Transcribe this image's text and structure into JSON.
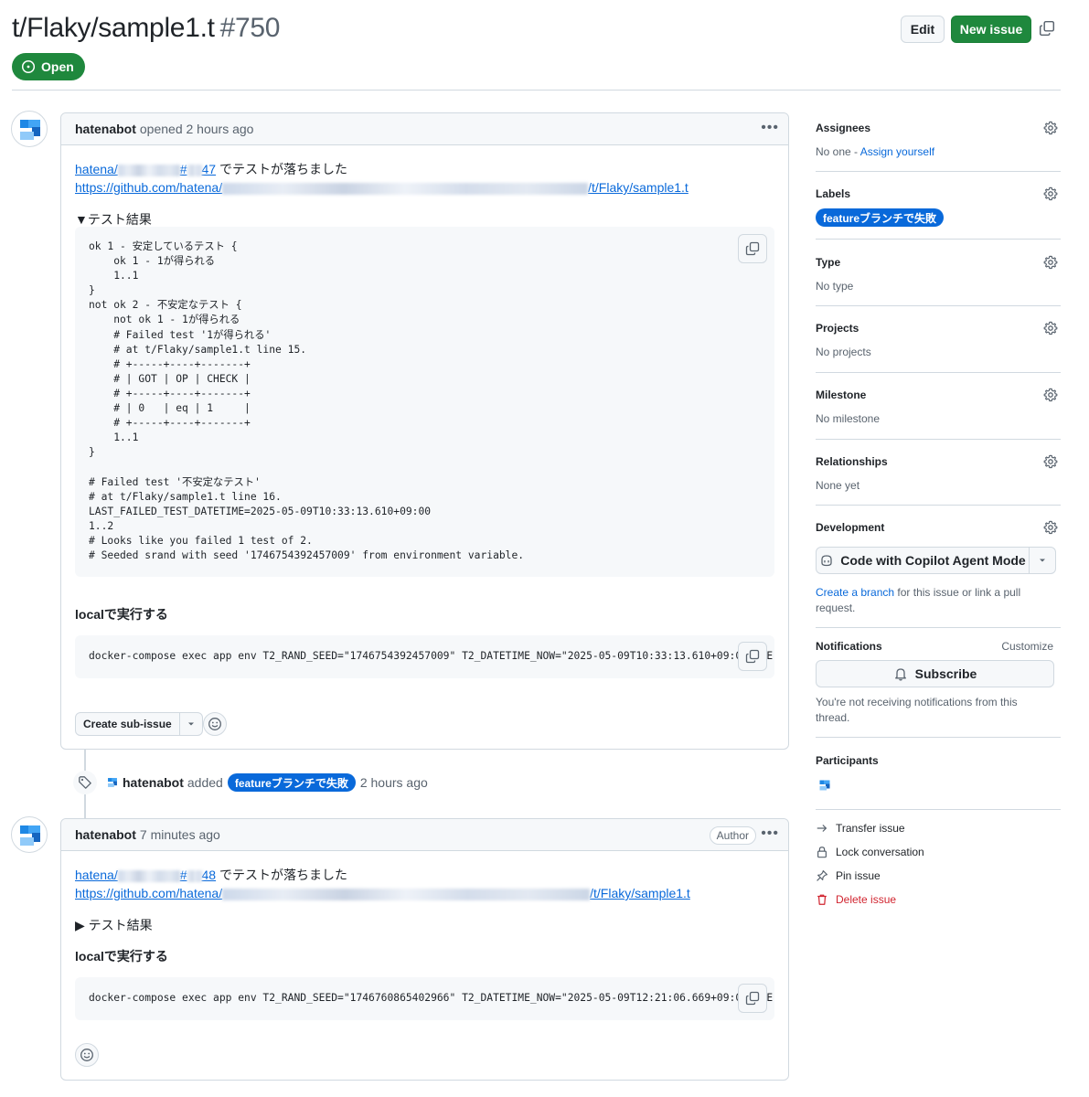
{
  "header": {
    "title": "t/Flaky/sample1.t",
    "number": "#750",
    "state": "Open",
    "edit_label": "Edit",
    "new_issue_label": "New issue"
  },
  "comments": [
    {
      "author": "hatenabot",
      "meta": "opened 2 hours ago",
      "line1_prefix": "hatena/",
      "line1_hash": "#",
      "line1_num": "47",
      "line1_suffix": "でテストが落ちました",
      "url_prefix": "https://github.com/hatena/",
      "url_suffix": "/t/Flaky/sample1.t",
      "details_label": "▼テスト結果",
      "code": "ok 1 - 安定しているテスト {\n    ok 1 - 1が得られる\n    1..1\n}\nnot ok 2 - 不安定なテスト {\n    not ok 1 - 1が得られる\n    # Failed test '1が得られる'\n    # at t/Flaky/sample1.t line 15.\n    # +-----+----+-------+\n    # | GOT | OP | CHECK |\n    # +-----+----+-------+\n    # | 0   | eq | 1     |\n    # +-----+----+-------+\n    1..1\n}\n\n# Failed test '不安定なテスト'\n# at t/Flaky/sample1.t line 16.\nLAST_FAILED_TEST_DATETIME=2025-05-09T10:33:13.610+09:00\n1..2\n# Looks like you failed 1 test of 2.\n# Seeded srand with seed '1746754392457009' from environment variable.",
      "local_heading": "localで実行する",
      "command": "docker-compose exec app env T2_RAND_SEED=\"1746754392457009\" T2_DATETIME_NOW=\"2025-05-09T10:33:13.610+09:00\" ME",
      "sub_issue_label": "Create sub-issue"
    },
    {
      "author": "hatenabot",
      "meta": "7 minutes ago",
      "badge": "Author",
      "line1_prefix": "hatena/",
      "line1_hash": "#",
      "line1_num": "48",
      "line1_suffix": "でテストが落ちました",
      "url_prefix": "https://github.com/hatena/",
      "url_suffix": "/t/Flaky/sample1.t",
      "details_label": "▶ テスト結果",
      "local_heading": "localで実行する",
      "command": "docker-compose exec app env T2_RAND_SEED=\"1746760865402966\" T2_DATETIME_NOW=\"2025-05-09T12:21:06.669+09:00\" ME"
    }
  ],
  "timeline_event": {
    "actor": "hatenabot",
    "action": "added",
    "label": "featureブランチで失敗",
    "time": "2 hours ago"
  },
  "sidebar": {
    "assignees": {
      "title": "Assignees",
      "value": "No one - ",
      "link": "Assign yourself"
    },
    "labels": {
      "title": "Labels",
      "label": "featureブランチで失敗",
      "label_color": "#0969da"
    },
    "type": {
      "title": "Type",
      "value": "No type"
    },
    "projects": {
      "title": "Projects",
      "value": "No projects"
    },
    "milestone": {
      "title": "Milestone",
      "value": "No milestone"
    },
    "relationships": {
      "title": "Relationships",
      "value": "None yet"
    },
    "development": {
      "title": "Development",
      "copilot_label": "Code with Copilot Agent Mode",
      "create_branch_link": "Create a branch",
      "create_branch_text": " for this issue or link a pull request."
    },
    "notifications": {
      "title": "Notifications",
      "customize": "Customize",
      "subscribe_label": "Subscribe",
      "note": "You're not receiving notifications from this thread."
    },
    "participants": {
      "title": "Participants"
    },
    "actions": {
      "transfer": "Transfer issue",
      "lock": "Lock conversation",
      "pin": "Pin issue",
      "delete": "Delete issue"
    }
  },
  "colors": {
    "accent": "#0969da",
    "open_green": "#1f883d",
    "danger": "#d1242f"
  },
  "icons": [
    "issue-open-icon",
    "copy-icon",
    "kebab-icon",
    "tag-icon",
    "gear-icon",
    "copilot-icon",
    "bell-icon",
    "arrow-right-icon",
    "lock-icon",
    "pin-icon",
    "trash-icon",
    "smiley-icon",
    "triangle-down-icon"
  ]
}
